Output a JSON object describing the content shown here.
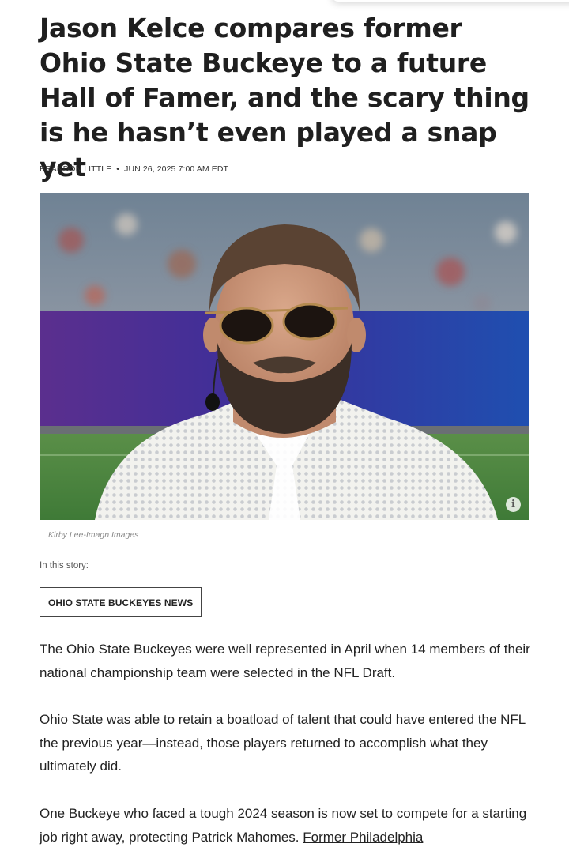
{
  "article": {
    "headline": "Jason Kelce compares former Ohio State Buckeye to a future Hall of Famer, and the scary thing is he hasn’t even played a snap yet",
    "byline": {
      "author": "BRANDON LITTLE",
      "separator": "•",
      "date": "JUN 26, 2025 7:00 AM EDT"
    },
    "image": {
      "credit": "Kirby Lee-Imagn Images",
      "info_icon": "info-icon"
    },
    "story": {
      "label": "In this story:",
      "tag": "OHIO STATE BUCKEYES NEWS"
    },
    "paragraphs": [
      "The Ohio State Buckeyes were well represented in April when 14 members of their national championship team were selected in the NFL Draft.",
      "Ohio State was able to retain a boatload of talent that could have entered the NFL the previous year—instead, those players returned to accomplish what they ultimately did.",
      "One Buckeye who faced a tough 2024 season is now set to compete for a starting job right away, protecting Patrick Mahomes."
    ],
    "paragraph3_link": "Former Philadelphia"
  }
}
